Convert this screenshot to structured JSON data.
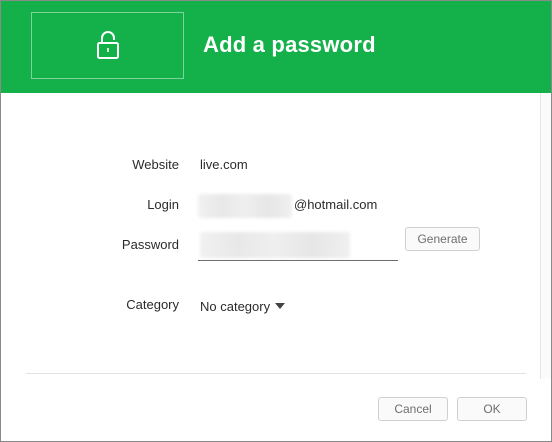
{
  "header": {
    "title": "Add a password",
    "icon": "lock-icon",
    "color": "#14b04a"
  },
  "form": {
    "website": {
      "label": "Website",
      "value": "live.com"
    },
    "login": {
      "label": "Login",
      "suffix": "@hotmail.com"
    },
    "password": {
      "label": "Password",
      "generate_label": "Generate"
    },
    "category": {
      "label": "Category",
      "selected": "No category"
    }
  },
  "footer": {
    "cancel_label": "Cancel",
    "ok_label": "OK"
  }
}
